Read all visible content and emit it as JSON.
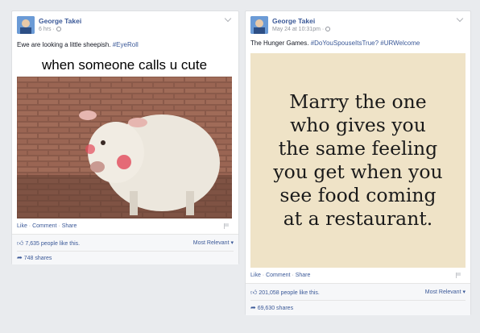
{
  "posts": [
    {
      "author": "George Takei",
      "timestamp": "6 hrs ·",
      "caption_text": "Ewe are looking a little sheepish. ",
      "caption_tag": "#EyeRoll",
      "meme_text": "when someone calls u cute",
      "actions": {
        "like": "Like",
        "comment": "Comment",
        "share": "Share",
        "sep": "·"
      },
      "likes": "7,635 people like this.",
      "sort": "Most Relevant",
      "shares": "748 shares"
    },
    {
      "author": "George Takei",
      "timestamp": "May 24 at 10:31pm ·",
      "caption_text": "The Hunger Games. ",
      "caption_tag": "#DoYouSpouseItsTrue? #URWelcome",
      "quote_lines": [
        "Marry the one",
        "who gives you",
        "the same feeling",
        "you get when you",
        "see food coming",
        "at a restaurant."
      ],
      "actions": {
        "like": "Like",
        "comment": "Comment",
        "share": "Share",
        "sep": "·"
      },
      "likes": "201,058 people like this.",
      "sort": "Most Relevant",
      "shares": "69,630 shares"
    }
  ],
  "colors": {
    "link": "#3b5998",
    "background": "#e9ebee",
    "quote_bg": "#efe3c7"
  }
}
